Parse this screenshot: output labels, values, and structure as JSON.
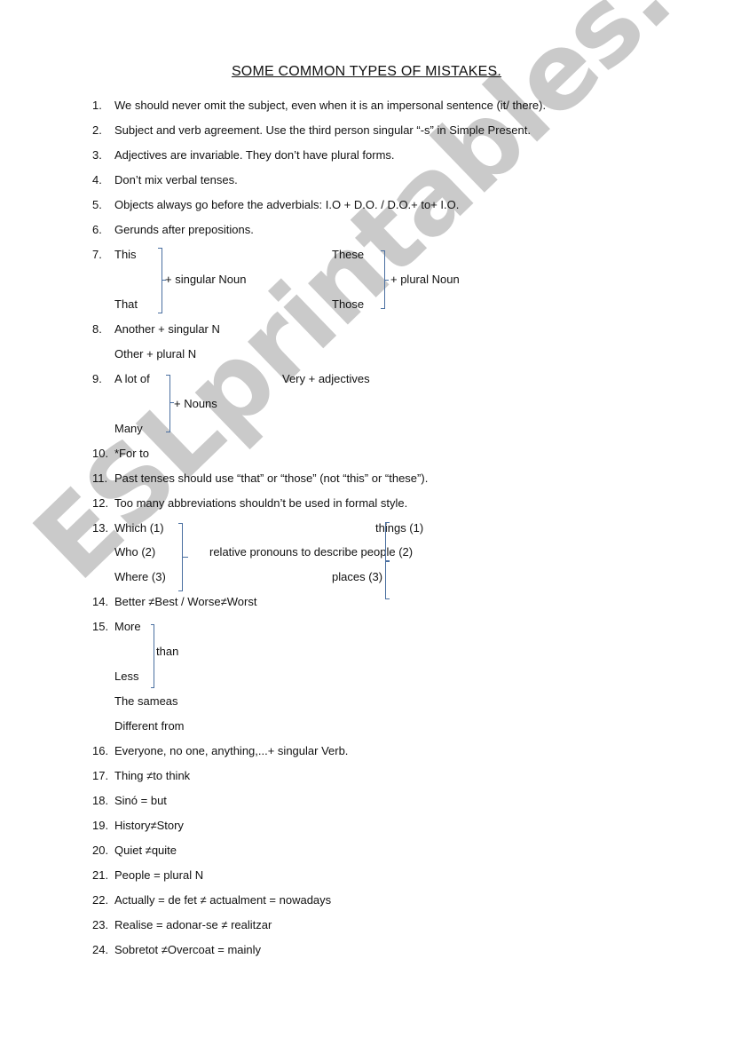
{
  "document": {
    "title": "SOME COMMON TYPES OF MISTAKES.",
    "watermark": "ESLprintables.com"
  },
  "items": {
    "n1": "1.",
    "i1": "We should never omit the subject, even when it is an impersonal sentence (it/ there).",
    "n2": "2.",
    "i2": "Subject and verb agreement. Use the third person singular “-s” in Simple Present.",
    "n3": "3.",
    "i3": "Adjectives are invariable. They don’t have plural forms.",
    "n4": "4.",
    "i4": "Don’t mix verbal tenses.",
    "n5": "5.",
    "i5": "Objects always go before the adverbials:  I.O + D.O. / D.O.+ to+ I.O.",
    "n6": "6.",
    "i6": "Gerunds after prepositions.",
    "n7": "7.",
    "i7": {
      "this": "This",
      "that": "That",
      "singular": "+ singular Noun",
      "these": "These",
      "those": "Those",
      "plural": "+ plural Noun"
    },
    "n8": "8.",
    "i8a": "Another + singular N",
    "i8b": "Other + plural N",
    "n9": "9.",
    "i9": {
      "alot": "A lot of",
      "many": "Many",
      "nouns": "+ Nouns",
      "very": "Very + adjectives"
    },
    "n10": "10.",
    "i10": "*For to",
    "n11": "11.",
    "i11": "Past tenses should use “that” or “those” (not “this” or “these”).",
    "n12": "12.",
    "i12": "Too many abbreviations shouldn’t be used in formal style.",
    "n13": "13.",
    "i13": {
      "which": "Which   (1)",
      "who": "Who (2)",
      "where": "Where (3)",
      "middle": "relative pronouns to describe people (2)",
      "things": "things (1)",
      "places": "places (3)"
    },
    "n14": "14.",
    "i14": "Better   ≠Best / Worse≠Worst",
    "n15": "15.",
    "i15": {
      "more": "More",
      "than": "than",
      "less": "Less",
      "same": "The sameas",
      "different": "Different from"
    },
    "n16": "16.",
    "i16": "Everyone, no one, anything,...+ singular Verb.",
    "n17": "17.",
    "i17": "Thing  ≠to think",
    "n18": "18.",
    "i18": "Sinó = but",
    "n19": "19.",
    "i19": "History≠Story",
    "n20": "20.",
    "i20": "Quiet ≠quite",
    "n21": "21.",
    "i21": "People = plural N",
    "n22": "22.",
    "i22": "Actually = de fet ≠ actualment = nowadays",
    "n23": "23.",
    "i23": "Realise = adonar-se ≠ realitzar",
    "n24": "24.",
    "i24": "Sobretot ≠Overcoat = mainly"
  }
}
